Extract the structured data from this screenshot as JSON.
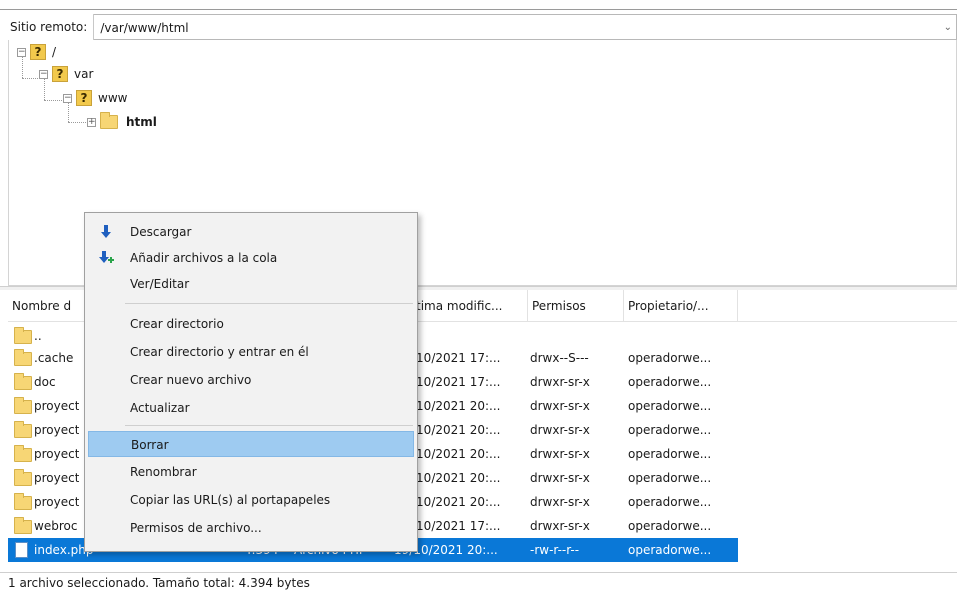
{
  "pathbar": {
    "label": "Sitio remoto:",
    "value": "/var/www/html"
  },
  "tree": {
    "root": {
      "label": "/",
      "expander": "−"
    },
    "var": {
      "label": "var",
      "expander": "−"
    },
    "www": {
      "label": "www",
      "expander": "−"
    },
    "html": {
      "label": "html",
      "expander": "+"
    },
    "unknown_glyph": "?"
  },
  "columns": {
    "name": "Nombre d",
    "modified": "tima modific...",
    "permissions": "Permisos",
    "owner": "Propietario/..."
  },
  "rows": [
    {
      "name": "..",
      "modified": "",
      "perms": "",
      "owner": ""
    },
    {
      "name": ".cache",
      "modified": "/10/2021 17:...",
      "perms": "drwx--S---",
      "owner": "operadorwe..."
    },
    {
      "name": "doc",
      "modified": "/10/2021 17:...",
      "perms": "drwxr-sr-x",
      "owner": "operadorwe..."
    },
    {
      "name": "proyect",
      "modified": "/10/2021 20:...",
      "perms": "drwxr-sr-x",
      "owner": "operadorwe..."
    },
    {
      "name": "proyect",
      "modified": "/10/2021 20:...",
      "perms": "drwxr-sr-x",
      "owner": "operadorwe..."
    },
    {
      "name": "proyect",
      "modified": "/10/2021 20:...",
      "perms": "drwxr-sr-x",
      "owner": "operadorwe..."
    },
    {
      "name": "proyect",
      "modified": "/10/2021 20:...",
      "perms": "drwxr-sr-x",
      "owner": "operadorwe..."
    },
    {
      "name": "proyect",
      "modified": "/10/2021 20:...",
      "perms": "drwxr-sr-x",
      "owner": "operadorwe..."
    },
    {
      "name": "webroc",
      "modified": "/10/2021 17:...",
      "perms": "drwxr-sr-x",
      "owner": "operadorwe..."
    },
    {
      "name": "index.php",
      "size": "4.394",
      "type": "Archivo PHP",
      "modified": "19/10/2021 20:...",
      "perms": "-rw-r--r--",
      "owner": "operadorwe..."
    }
  ],
  "status": "1 archivo seleccionado. Tamaño total: 4.394 bytes",
  "context_menu": {
    "download": "Descargar",
    "add_queue": "Añadir archivos a la cola",
    "view_edit": "Ver/Editar",
    "create_dir": "Crear directorio",
    "create_dir_enter": "Crear directorio y entrar en él",
    "new_file": "Crear nuevo archivo",
    "refresh": "Actualizar",
    "delete": "Borrar",
    "rename": "Renombrar",
    "copy_url": "Copiar las URL(s) al portapapeles",
    "permissions": "Permisos de archivo..."
  },
  "colors": {
    "selection": "#0a78d7",
    "menu_highlight": "#9ecbf1",
    "folder": "#f7d675",
    "question_icon": "#f2c94c"
  },
  "icons": {
    "download": "download-arrow-icon",
    "add_queue": "add-to-queue-icon",
    "folder": "folder-icon",
    "file": "php-file-icon",
    "unknown": "question-mark-icon"
  }
}
